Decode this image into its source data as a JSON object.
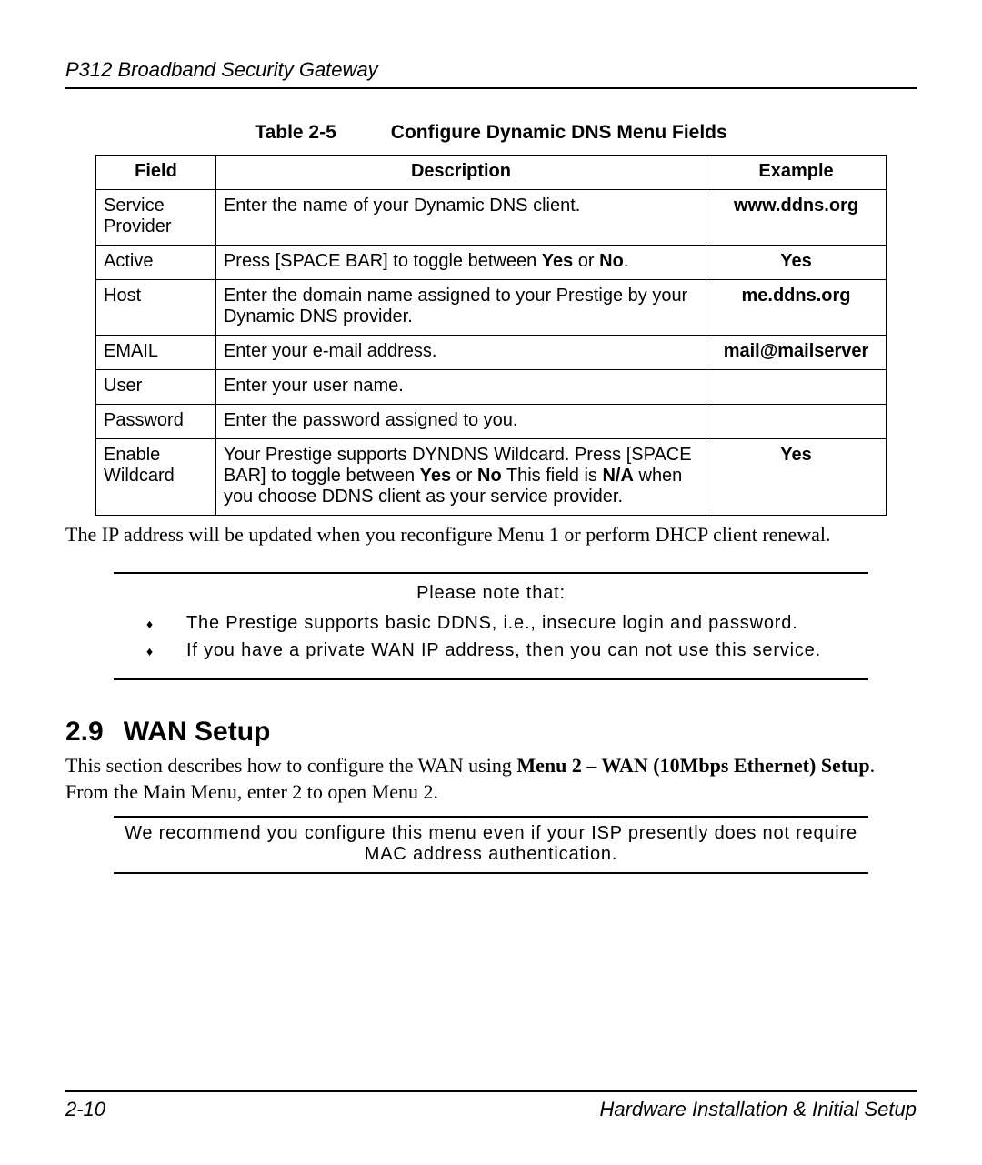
{
  "header": {
    "product": "P312  Broadband Security Gateway"
  },
  "table": {
    "caption_number": "Table 2-5",
    "caption_title": "Configure Dynamic DNS Menu Fields",
    "headers": {
      "field": "Field",
      "description": "Description",
      "example": "Example"
    },
    "rows": [
      {
        "field": "Service Provider",
        "desc": "Enter the name of your Dynamic DNS client.",
        "example": "www.ddns.org"
      },
      {
        "field": "Active",
        "desc_pre": "Press [SPACE BAR] to toggle between ",
        "desc_b1": "Yes",
        "desc_mid1": " or ",
        "desc_b2": "No",
        "desc_post": ".",
        "example": "Yes"
      },
      {
        "field": "Host",
        "desc": "Enter the domain name assigned to your Prestige by your Dynamic DNS provider.",
        "example": "me.ddns.org"
      },
      {
        "field": "EMAIL",
        "desc": "Enter your e-mail address.",
        "example": "mail@mailserver"
      },
      {
        "field": "User",
        "desc": "Enter your user name.",
        "example": ""
      },
      {
        "field": "Password",
        "desc": "Enter the password assigned to you.",
        "example": ""
      },
      {
        "field": "Enable Wildcard",
        "desc_pre": "Your Prestige supports DYNDNS Wildcard. Press [SPACE BAR] to toggle between ",
        "desc_b1": "Yes",
        "desc_mid1": " or ",
        "desc_b2": "No",
        "desc_mid2": " This field is ",
        "desc_b3": "N/A",
        "desc_post": " when you choose DDNS client as your service provider.",
        "example": "Yes"
      }
    ]
  },
  "post_table_text": "The IP address will be updated when you reconfigure Menu 1 or perform DHCP client renewal.",
  "note": {
    "title": "Please note that:",
    "items": [
      "The Prestige supports basic DDNS, i.e., insecure login and password.",
      "If you have a private WAN IP address, then you can not use this service."
    ]
  },
  "section": {
    "number": "2.9",
    "title": "WAN Setup",
    "para_pre": "This section describes how to configure the WAN using ",
    "para_bold": "Menu 2 – WAN (10Mbps Ethernet) Setup",
    "para_post": ". From the Main Menu, enter 2 to open Menu 2."
  },
  "recommend_note": "We recommend you configure this menu even if your ISP presently does not require MAC address authentication.",
  "footer": {
    "page": "2-10",
    "chapter": "Hardware Installation & Initial Setup"
  }
}
